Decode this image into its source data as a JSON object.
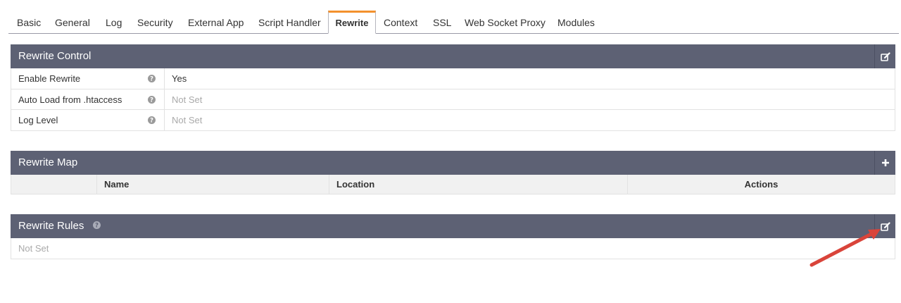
{
  "tabs": [
    {
      "label": "Basic"
    },
    {
      "label": "General"
    },
    {
      "label": "Log"
    },
    {
      "label": "Security"
    },
    {
      "label": "External App"
    },
    {
      "label": "Script Handler"
    },
    {
      "label": "Rewrite",
      "active": true
    },
    {
      "label": "Context"
    },
    {
      "label": "SSL"
    },
    {
      "label": "Web Socket Proxy"
    },
    {
      "label": "Modules"
    }
  ],
  "rewrite_control": {
    "title": "Rewrite Control",
    "edit_icon": "edit-icon",
    "rows": [
      {
        "label": "Enable Rewrite",
        "value": "Yes"
      },
      {
        "label": "Auto Load from .htaccess",
        "value": "Not Set"
      },
      {
        "label": "Log Level",
        "value": "Not Set"
      }
    ]
  },
  "rewrite_map": {
    "title": "Rewrite Map",
    "add_icon": "plus-icon",
    "columns": {
      "name": "Name",
      "location": "Location",
      "actions": "Actions"
    }
  },
  "rewrite_rules": {
    "title": "Rewrite Rules",
    "edit_icon": "edit-icon",
    "value": "Not Set"
  },
  "colors": {
    "panel_header": "#5d6174",
    "active_tab_accent": "#f3912d",
    "annotation_arrow": "#d9443a"
  }
}
